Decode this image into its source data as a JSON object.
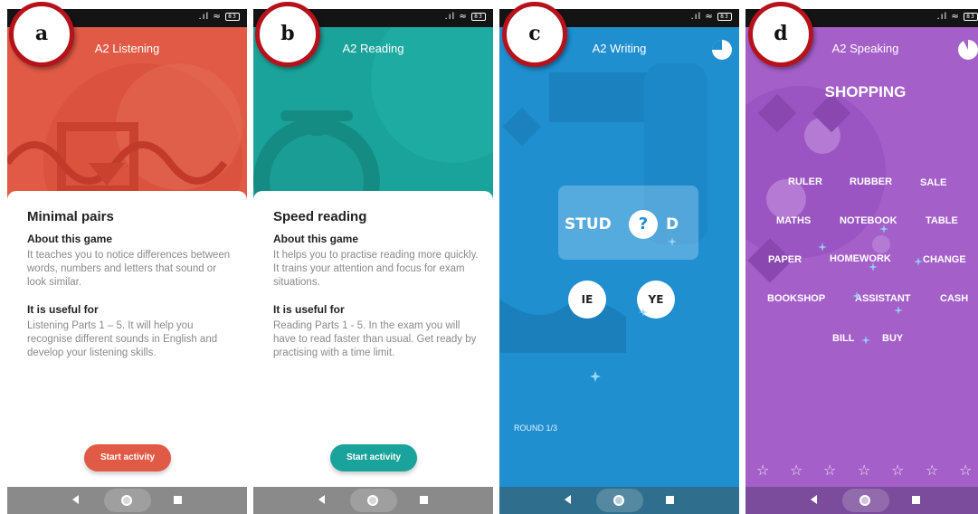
{
  "colors": {
    "listening": "#e05a45",
    "reading": "#1aa39a",
    "writing": "#1f8fd0",
    "speaking": "#a45fc9",
    "badge_border": "#b5121b"
  },
  "panels": {
    "a": {
      "badge": "a",
      "header": "A2 Listening",
      "card_title": "Minimal pairs",
      "about_heading": "About this game",
      "about_text": "It teaches you to notice differences between words, numbers and letters that sound or look similar.",
      "useful_heading": "It is useful for",
      "useful_text": "Listening Parts 1 – 5. It will help you recognise different sounds in English and develop your listening skills.",
      "button": "Start activity"
    },
    "b": {
      "badge": "b",
      "header": "A2 Reading",
      "card_title": "Speed reading",
      "about_heading": "About this game",
      "about_text": "It helps you to practise reading more quickly. It trains your attention and focus for exam situations.",
      "useful_heading": "It is useful for",
      "useful_text": "Reading Parts 1 - 5. In the exam you will have to read faster than usual. Get ready by practising with a time limit.",
      "button": "Start activity"
    },
    "c": {
      "badge": "c",
      "header": "A2 Writing",
      "word_prefix": "STUD",
      "word_mark": "?",
      "word_suffix": "D",
      "option_1": "IE",
      "option_2": "YE",
      "round": "ROUND 1/3"
    },
    "d": {
      "badge": "d",
      "header": "A2 Speaking",
      "title": "SHOPPING",
      "words": [
        "RULER",
        "RUBBER",
        "SALE",
        "MATHS",
        "NOTEBOOK",
        "TABLE",
        "PAPER",
        "HOMEWORK",
        "CHANGE",
        "BOOKSHOP",
        "ASSISTANT",
        "CASH",
        "BILL",
        "BUY"
      ],
      "star_glyph": "☆"
    }
  }
}
